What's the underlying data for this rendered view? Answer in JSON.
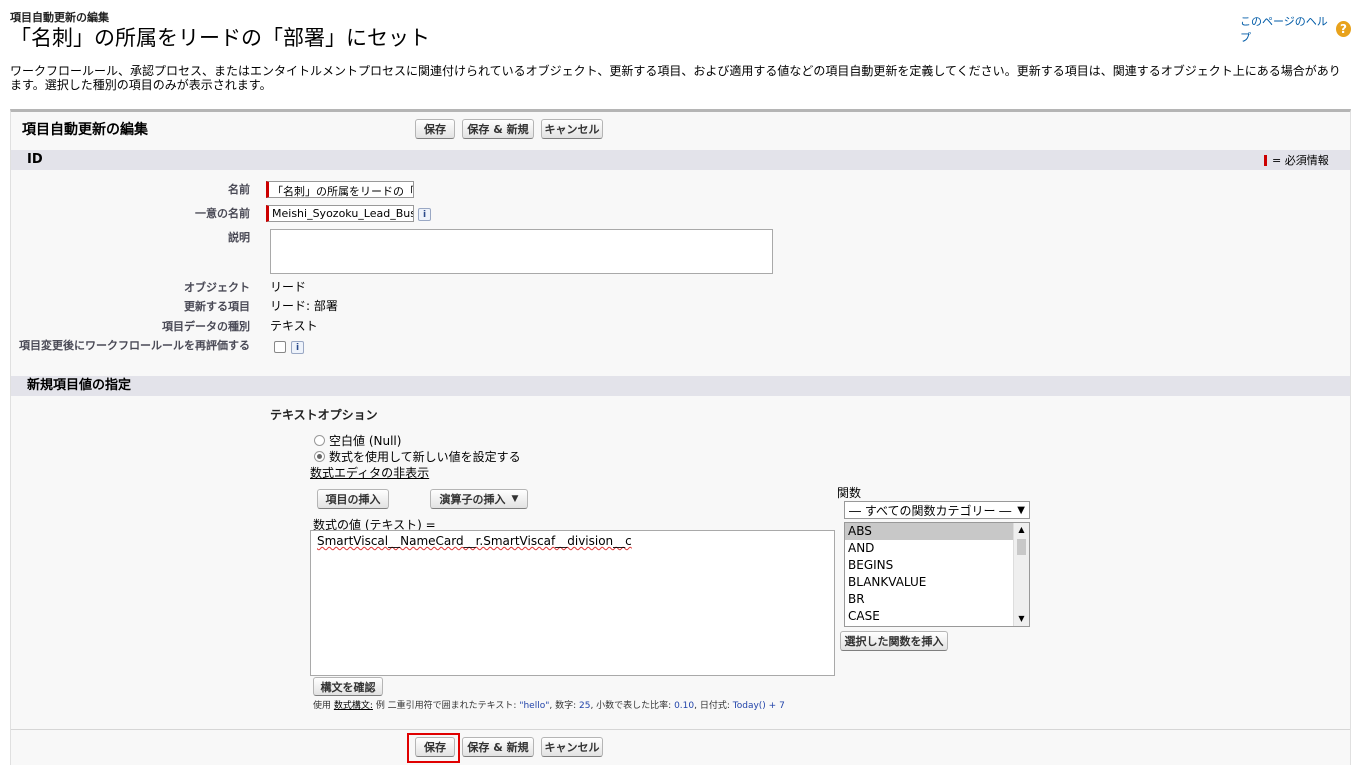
{
  "header": {
    "subtitle": "項目自動更新の編集",
    "title": "「名刺」の所属をリードの「部署」にセット",
    "help_link": "このページのヘルプ",
    "description": "ワークフロールール、承認プロセス、またはエンタイトルメントプロセスに関連付けられているオブジェクト、更新する項目、および適用する値などの項目自動更新を定義してください。更新する項目は、関連するオブジェクト上にある場合があります。選択した種別の項目のみが表示されます。"
  },
  "panel": {
    "title": "項目自動更新の編集",
    "save": "保存",
    "save_new": "保存 & 新規",
    "cancel": "キャンセル"
  },
  "id_section": {
    "title": "ID",
    "required_legend": "= 必須情報",
    "name_label": "名前",
    "name_value": "「名刺」の所属をリードの「部署」にセット",
    "unique_name_label": "一意の名前",
    "unique_name_value": "Meishi_Syozoku_Lead_Busho",
    "description_label": "説明",
    "object_label": "オブジェクト",
    "object_value": "リード",
    "field_label": "更新する項目",
    "field_value": "リード: 部署",
    "datatype_label": "項目データの種別",
    "datatype_value": "テキスト",
    "reevaluate_label": "項目変更後にワークフロールールを再評価する",
    "reevaluate_checked": false
  },
  "value_section": {
    "title": "新規項目値の指定",
    "text_options": "テキストオプション",
    "radio_null": "空白値 (Null)",
    "radio_formula": "数式を使用して新しい値を設定する",
    "selected_option": "formula",
    "hide_editor": "数式エディタの非表示",
    "insert_field": "項目の挿入",
    "insert_operator": "演算子の挿入",
    "formula_label": "数式の値 (テキスト) =",
    "formula_value": "SmartViscal__NameCard__r.SmartViscaf__division__c",
    "functions_label": "関数",
    "function_category": "― すべての関数カテゴリー ―",
    "functions": [
      "ABS",
      "AND",
      "BEGINS",
      "BLANKVALUE",
      "BR",
      "CASE"
    ],
    "selected_function": "ABS",
    "insert_function": "選択した関数を挿入",
    "check_syntax": "構文を確認",
    "hint_prefix": "使用",
    "hint_link": "数式構文:",
    "hint_text": "例 二重引用符で囲まれたテキスト:",
    "hint_ex1": "\"hello\"",
    "hint_num": ", 数字:",
    "hint_ex2": "25",
    "hint_pct": ", 小数で表した比率:",
    "hint_ex3": "0.10",
    "hint_date": ", 日付式:",
    "hint_ex4": "Today() + 7"
  },
  "colors": {
    "required": "#cc0000",
    "highlight": "#e00000",
    "section_bg": "#e3e3ea",
    "help_link": "#015ba7"
  }
}
